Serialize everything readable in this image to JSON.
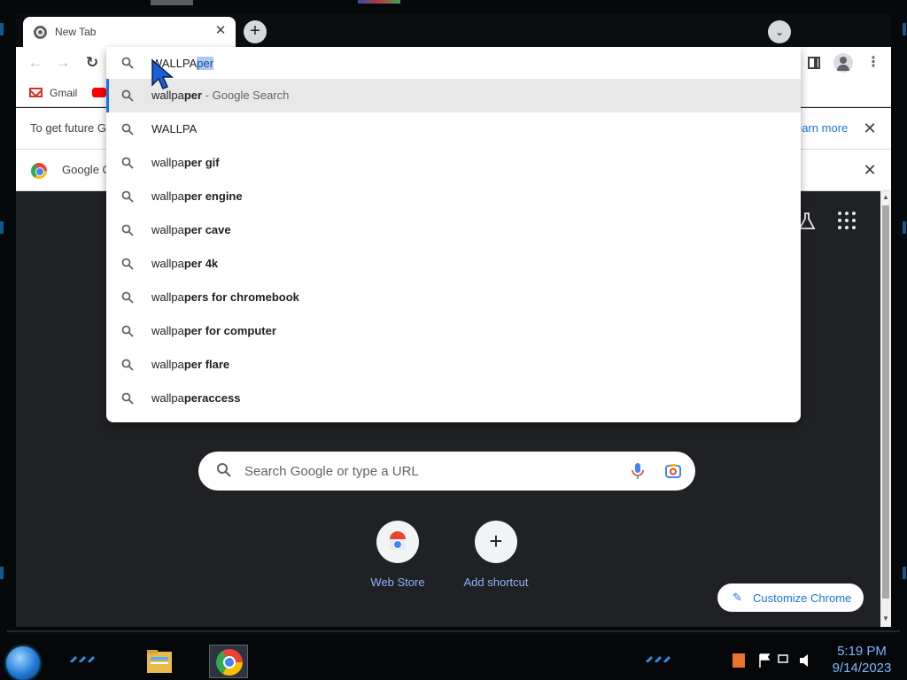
{
  "browser": {
    "tab": {
      "title": "New Tab",
      "close_glyph": "✕"
    },
    "new_tab_glyph": "+",
    "tab_search_glyph": "⌄",
    "nav": {
      "back_glyph": "←",
      "forward_glyph": "→",
      "reload_glyph": "↻",
      "menu_glyph": "⋮"
    },
    "bookmarks": [
      {
        "label": "Gmail",
        "icon": "gmail-icon"
      },
      {
        "label": "",
        "icon": "youtube-icon"
      }
    ],
    "infobars": [
      {
        "text": "To get future G",
        "link": "earn more",
        "close_glyph": "✕"
      },
      {
        "text": "Google C",
        "close_glyph": "✕",
        "icon": "chrome-icon"
      }
    ]
  },
  "omnibox": {
    "typed": "WALLPA",
    "autocompleted": "per",
    "suggestions": [
      {
        "prefix": "wallpa",
        "bold": "per",
        "suffix": " - Google Search",
        "active": true
      },
      {
        "prefix": "WALLPA",
        "bold": "",
        "suffix": "",
        "active": false
      },
      {
        "prefix": "wallpa",
        "bold": "per gif",
        "suffix": "",
        "active": false
      },
      {
        "prefix": "wallpa",
        "bold": "per engine",
        "suffix": "",
        "active": false
      },
      {
        "prefix": "wallpa",
        "bold": "per cave",
        "suffix": "",
        "active": false
      },
      {
        "prefix": "wallpa",
        "bold": "per 4k",
        "suffix": "",
        "active": false
      },
      {
        "prefix": "wallpa",
        "bold": "pers for chromebook",
        "suffix": "",
        "active": false
      },
      {
        "prefix": "wallpa",
        "bold": "per for computer",
        "suffix": "",
        "active": false
      },
      {
        "prefix": "wallpa",
        "bold": "per flare",
        "suffix": "",
        "active": false
      },
      {
        "prefix": "wallpa",
        "bold": "peraccess",
        "suffix": "",
        "active": false
      }
    ]
  },
  "ntp": {
    "search_placeholder": "Search Google or type a URL",
    "shortcuts": [
      {
        "label": "Web Store",
        "icon": "web-store-icon"
      },
      {
        "label": "Add shortcut",
        "icon": "plus-icon",
        "glyph": "+"
      }
    ],
    "customize_label": "Customize Chrome",
    "customize_glyph": "✎"
  },
  "taskbar": {
    "clock_time": "5:19 PM",
    "clock_date": "9/14/2023"
  },
  "colors": {
    "accent_blue": "#1a73e8",
    "link_blue_dark": "#8ab4f8",
    "ntp_background": "#202124",
    "clock": "#7fb4ff"
  }
}
